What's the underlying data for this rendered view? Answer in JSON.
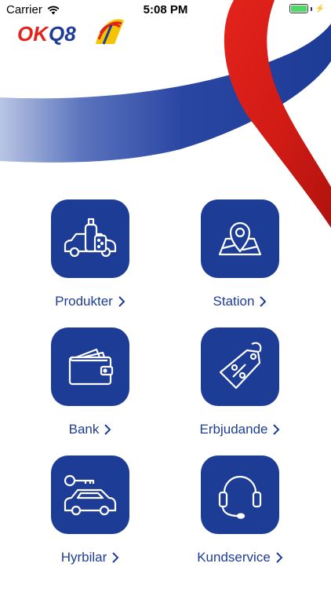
{
  "status_bar": {
    "carrier": "Carrier",
    "time": "5:08 PM"
  },
  "brand": {
    "logo_text": "OKQ8",
    "primary_color": "#1d3c96",
    "accent_red": "#d41f1c",
    "accent_yellow": "#f5c400"
  },
  "menu": {
    "items": [
      {
        "label": "Produkter",
        "icon": "car-products-icon"
      },
      {
        "label": "Station",
        "icon": "map-pin-icon"
      },
      {
        "label": "Bank",
        "icon": "wallet-icon"
      },
      {
        "label": "Erbjudande",
        "icon": "price-tag-icon"
      },
      {
        "label": "Hyrbilar",
        "icon": "car-key-icon"
      },
      {
        "label": "Kundservice",
        "icon": "headset-icon"
      }
    ]
  }
}
